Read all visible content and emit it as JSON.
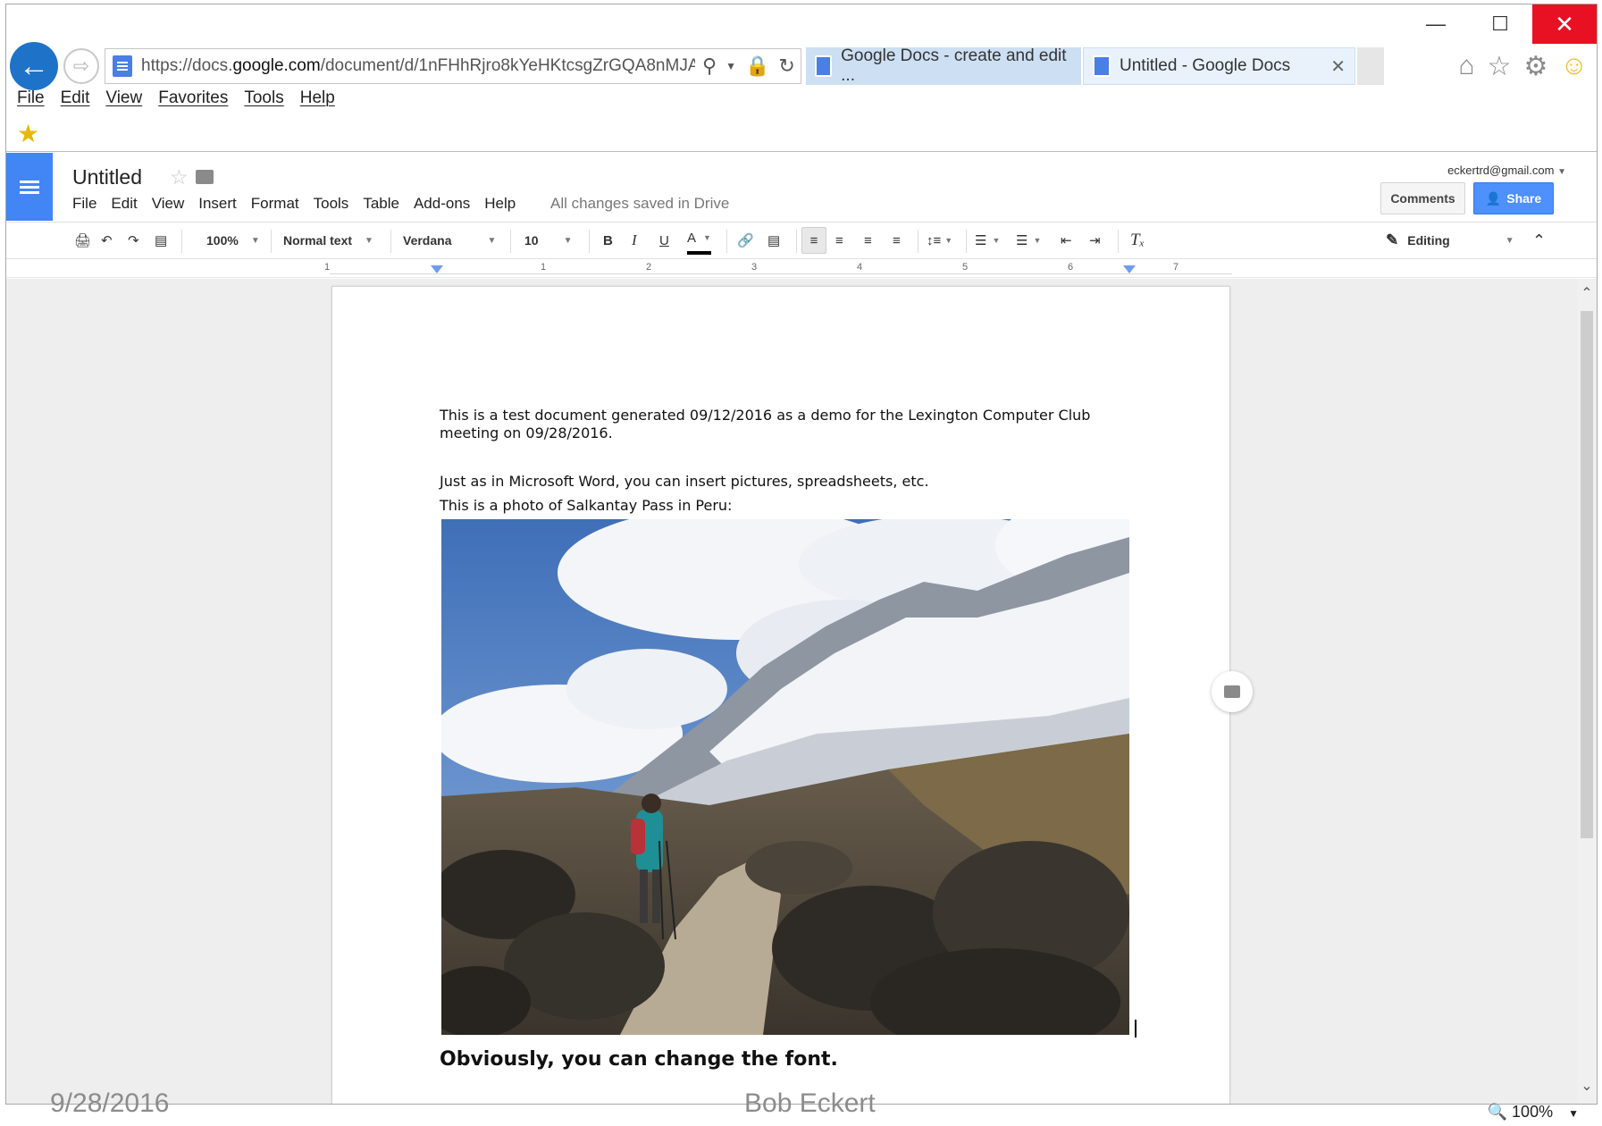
{
  "browser": {
    "url_prefix": "https://docs.",
    "url_domain": "google.com",
    "url_rest": "/document/d/1nFHhRjro8kYeHKtcsgZrGQA8nMJA",
    "tabs": [
      {
        "label": "Google Docs - create and edit ..."
      },
      {
        "label": "Untitled - Google Docs"
      }
    ],
    "menu": [
      "File",
      "Edit",
      "View",
      "Favorites",
      "Tools",
      "Help"
    ]
  },
  "docs": {
    "title": "Untitled",
    "menu": [
      "File",
      "Edit",
      "View",
      "Insert",
      "Format",
      "Tools",
      "Table",
      "Add-ons",
      "Help"
    ],
    "saved_status": "All changes saved in Drive",
    "account": "eckertrd@gmail.com",
    "comments_label": "Comments",
    "share_label": "Share"
  },
  "toolbar": {
    "zoom": "100%",
    "style": "Normal text",
    "font": "Verdana",
    "size": "10",
    "bold": "B",
    "italic": "I",
    "underline": "U",
    "text_color": "A",
    "mode": "Editing"
  },
  "ruler": {
    "numbers": [
      "1",
      "1",
      "2",
      "3",
      "4",
      "5",
      "6",
      "7"
    ]
  },
  "document": {
    "para1": "This is a test document generated 09/12/2016 as a demo for the Lexington Computer Club meeting on 09/28/2016.",
    "para2": "Just as in Microsoft Word, you can  insert pictures, spreadsheets, etc.",
    "para3": "This is a photo of Salkantay Pass in Peru:",
    "para4": "Obviously, you can change the font."
  },
  "status": {
    "zoom": "100%"
  },
  "slide_footer": {
    "date": "9/28/2016",
    "author": "Bob Eckert"
  },
  "colors": {
    "docs_blue": "#4285f4",
    "share_blue": "#4d90fe",
    "ie_close_red": "#e81123"
  }
}
